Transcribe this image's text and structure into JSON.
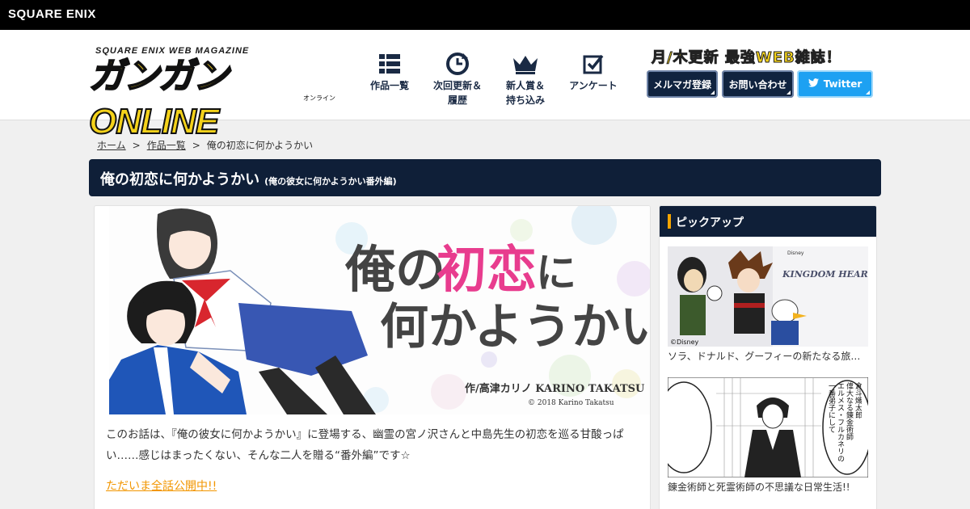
{
  "brand": {
    "top_logo": "SQUARE ENIX"
  },
  "logo": {
    "sub": "SQUARE ENIX WEB MAGAZINE",
    "main": "ガンガンONLINE",
    "kana": "オンライン"
  },
  "nav": [
    {
      "label": "作品一覧",
      "icon": "grid-icon"
    },
    {
      "label": "次回更新＆\n履歴",
      "icon": "refresh-clock-icon"
    },
    {
      "label": "新人賞＆\n持ち込み",
      "icon": "crown-icon"
    },
    {
      "label": "アンケート",
      "icon": "checkbox-icon"
    }
  ],
  "header": {
    "catch": "月/木更新 最強WEB雑誌！",
    "mailmag": "メルマガ登録",
    "contact": "お問い合わせ",
    "twitter": "Twitter"
  },
  "breadcrumb": {
    "home": "ホーム",
    "list": "作品一覧",
    "current": "俺の初恋に何かようかい"
  },
  "title": {
    "main": "俺の初恋に何かようかい",
    "sub": "(俺の彼女に何かようかい番外編)"
  },
  "banner": {
    "line1a": "俺の",
    "line1b": "初恋",
    "line1c": "に",
    "line2": "何かようかい",
    "credit": "作/高津カリノ  KARINO TAKATSU",
    "copyright": "© 2018 Karino Takatsu"
  },
  "description": "このお話は、『俺の彼女に何かようかい』に登場する、幽霊の宮ノ沢さんと中島先生の初恋を巡る甘酸っぱい……感じはまったくない、そんな二人を贈る“番外編”です☆",
  "read_link": "ただいま全話公開中!!",
  "sidebar": {
    "heading": "ピックアップ",
    "items": [
      {
        "caption": "ソラ、ドナルド、グーフィーの新たなる旅…",
        "logo_text": "KINGDOM HEARTS III",
        "copyright": "©Disney"
      },
      {
        "caption": "錬金術師と死霊術師の不思議な日常生活!!",
        "bubble": "倉斗熾太郎\n偉大なる錬金術師\nエルメス・フルカネリの\n一番弟子にして"
      }
    ]
  },
  "colors": {
    "navy": "#0f1f38",
    "accent": "#f4a400",
    "link": "#f29600",
    "twitter": "#1da1f2",
    "title_pink": "#e83c8e"
  }
}
